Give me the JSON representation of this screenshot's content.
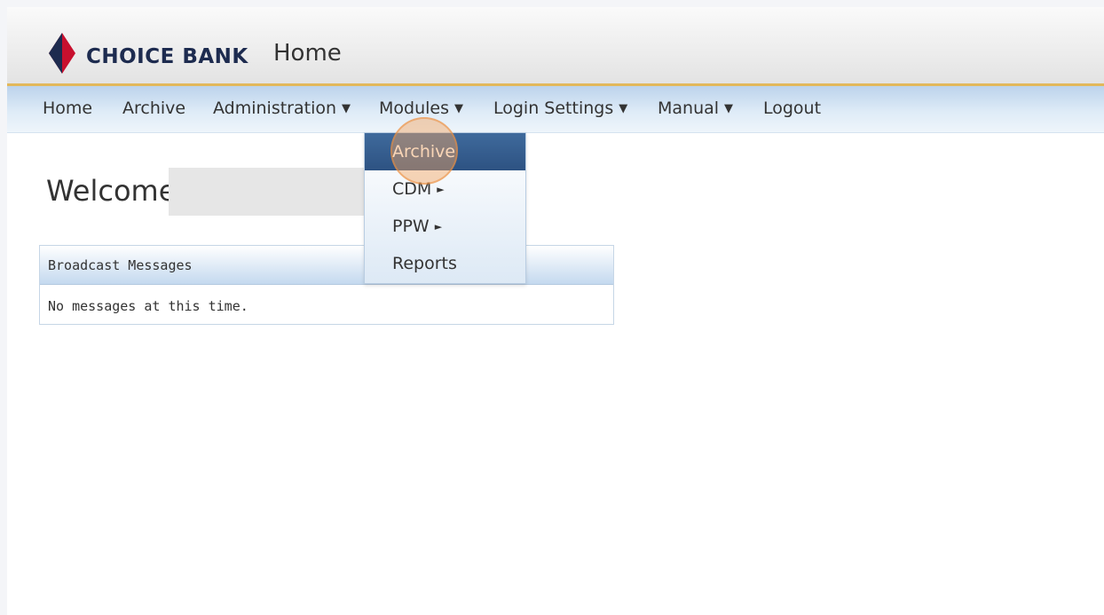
{
  "header": {
    "brand": "CHOICE BANK",
    "title": "Home",
    "brand_colors": {
      "red": "#c8102e",
      "navy": "#1d2b4f"
    }
  },
  "nav": {
    "items": [
      {
        "label": "Home"
      },
      {
        "label": "Archive"
      },
      {
        "label": "Administration",
        "caret": "▼"
      },
      {
        "label": "Modules",
        "caret": "▼"
      },
      {
        "label": "Login Settings",
        "caret": "▼"
      },
      {
        "label": "Manual",
        "caret": "▼"
      },
      {
        "label": "Logout"
      }
    ]
  },
  "modules_menu": {
    "items": [
      {
        "label": "Archive",
        "active": true
      },
      {
        "label": "CDM",
        "submenu_arrow": "►"
      },
      {
        "label": "PPW",
        "submenu_arrow": "►"
      },
      {
        "label": "Reports"
      }
    ]
  },
  "main": {
    "welcome": "Welcome",
    "broadcast": {
      "title": "Broadcast Messages",
      "message": "No messages at this time."
    }
  }
}
